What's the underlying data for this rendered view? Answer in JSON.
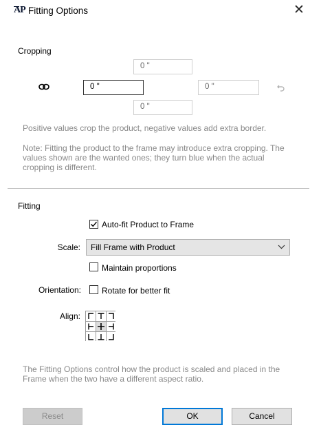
{
  "window": {
    "app_icon": "AP",
    "title": "Fitting Options",
    "close_glyph": "✕"
  },
  "cropping": {
    "label": "Cropping",
    "top": "0 \"",
    "left": "0 \"",
    "right": "0 \"",
    "bottom": "0 \"",
    "link_icon": "chain-link-icon",
    "reset_icon": "undo-arrow-icon",
    "hint1": "Positive values crop the product, negative values add extra border.",
    "hint2": "Note: Fitting the product to the frame may introduce extra cropping. The values shown are the wanted ones; they turn blue when the actual cropping is different."
  },
  "fitting": {
    "label": "Fitting",
    "autofit_label": "Auto-fit Product to Frame",
    "autofit_checked": true,
    "scale_label": "Scale:",
    "scale_value": "Fill Frame with Product",
    "maintain_label": "Maintain proportions",
    "maintain_checked": false,
    "orientation_label": "Orientation:",
    "rotate_label": "Rotate for better fit",
    "rotate_checked": false,
    "align_label": "Align:",
    "align_selected": "center",
    "hint": "The Fitting Options control how the product is scaled and placed in the Frame when the two have a different aspect ratio."
  },
  "buttons": {
    "reset": "Reset",
    "ok": "OK",
    "cancel": "Cancel"
  }
}
